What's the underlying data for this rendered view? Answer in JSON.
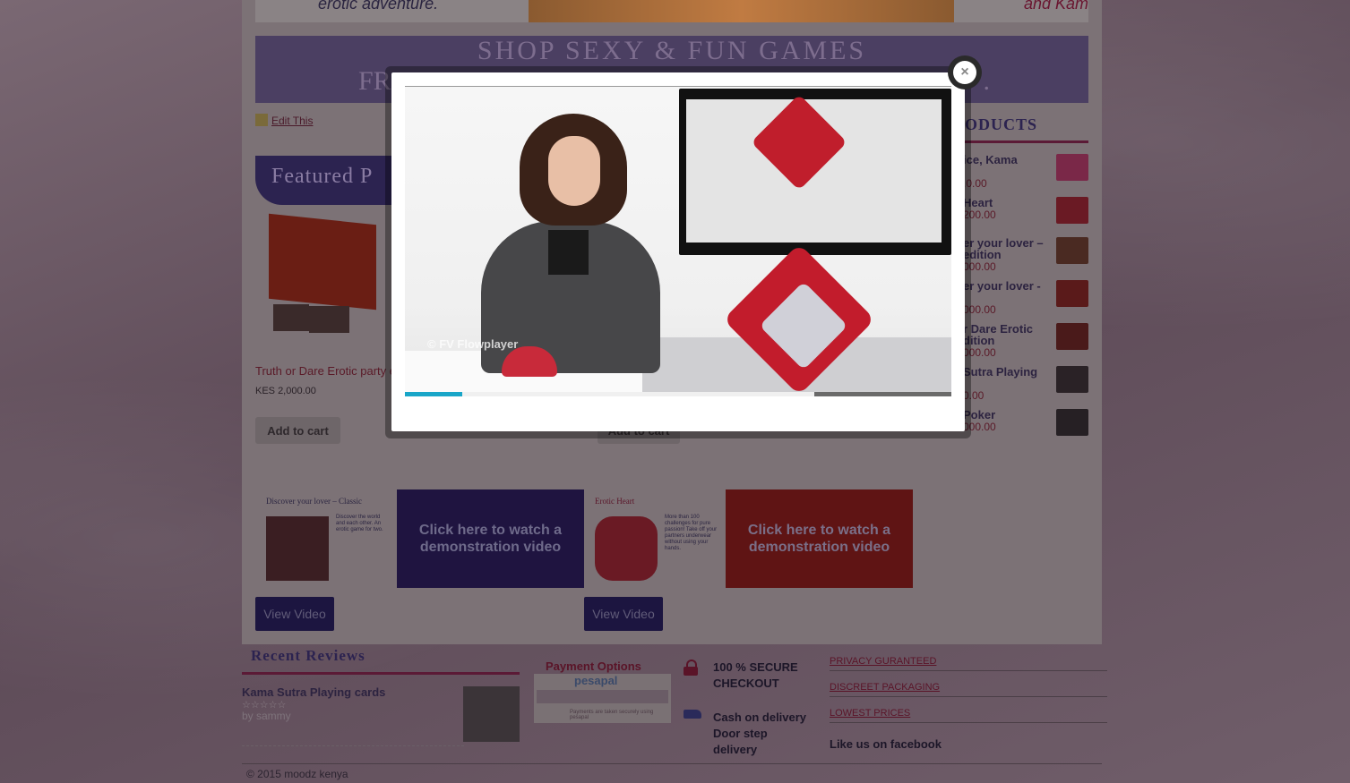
{
  "top_banner": {
    "left_text": "erotic adventure.",
    "right_text": "and Kam"
  },
  "shop_banner": {
    "title": "SHOP SEXY & FUN GAMES",
    "sub_left": "FR",
    "sub_right": "."
  },
  "edit_link": "Edit This",
  "featured": {
    "heading": "Featured P",
    "product": {
      "name": "Truth or Dare Erotic party e",
      "price": "KES 2,000.00",
      "cart_label": "Add to cart"
    },
    "second_cart_label": "Add to cart"
  },
  "sidebar": {
    "heading": "ODUCTS",
    "items": [
      {
        "name": "ice, Kama",
        "price": ".0.00"
      },
      {
        "name": "Heart",
        "price": "200.00"
      },
      {
        "name": "er your lover – edition",
        "price": "000.00"
      },
      {
        "name": "er your lover -",
        "price": "000.00"
      },
      {
        "name": "r Dare Erotic dition",
        "price": "000.00"
      },
      {
        "name": "Sutra Playing",
        "price": "0.00"
      },
      {
        "name": "Poker",
        "price": "000.00"
      }
    ]
  },
  "promos": [
    {
      "title": "Discover your lover – Classic",
      "blurb": "Discover the world and each other. An erotic game for two.",
      "demo_text": "Click here to watch a demonstration video",
      "button": "View Video"
    },
    {
      "title": "Erotic Heart",
      "blurb": "More than 100 challenges for pure passion! Take off your partners underwear without using your hands.",
      "demo_text": "Click here to watch a demonstration video",
      "button": "View Video"
    }
  ],
  "reviews": {
    "heading": "Recent Reviews",
    "items": [
      {
        "title": "Kama Sutra Playing cards",
        "stars": "☆☆☆☆☆",
        "by": "by sammy"
      }
    ]
  },
  "payment": {
    "title": "Payment Options",
    "provider": "pesapal",
    "note": "Payments are taken securely using pesapal"
  },
  "trust": {
    "secure": "100 % SECURE CHECKOUT",
    "delivery": "Cash on delivery Door step delivery"
  },
  "features": [
    "PRIVACY GURANTEED",
    "DISCREET PACKAGING",
    "LOWEST PRICES"
  ],
  "facebook": "Like us on facebook",
  "copyright": "© 2015 moodz kenya",
  "video_modal": {
    "watermark": "© FV Flowplayer",
    "close_icon": "close-icon",
    "progress": 0.14,
    "accent": "#19a6c8"
  }
}
